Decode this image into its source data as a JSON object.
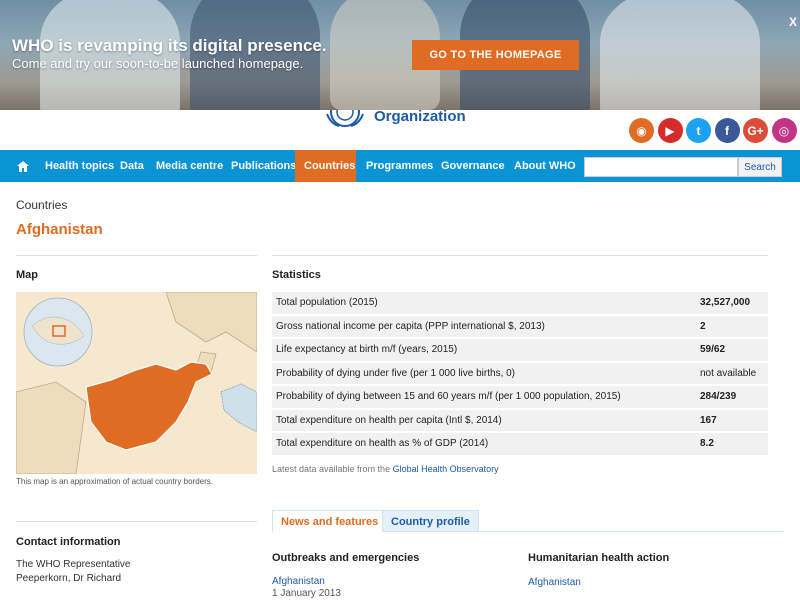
{
  "banner": {
    "title": "WHO is revamping its digital presence.",
    "subtitle": "Come and try our soon-to-be launched homepage.",
    "cta_label": "GO TO THE HOMEPAGE",
    "close_label": "X"
  },
  "header": {
    "logo_text": "Organization",
    "social": [
      {
        "icon": "rss-icon",
        "glyph": "◉",
        "color": "#e06b22"
      },
      {
        "icon": "youtube-icon",
        "glyph": "▶",
        "color": "#d62b2b"
      },
      {
        "icon": "twitter-icon",
        "glyph": "t",
        "color": "#1da1f2"
      },
      {
        "icon": "facebook-icon",
        "glyph": "f",
        "color": "#3b5998"
      },
      {
        "icon": "google-plus-icon",
        "glyph": "G+",
        "color": "#dd4b39"
      },
      {
        "icon": "instagram-icon",
        "glyph": "◎",
        "color": "#c13584"
      }
    ]
  },
  "nav": {
    "items": [
      "Health topics",
      "Data",
      "Media centre",
      "Publications",
      "Countries",
      "Programmes",
      "Governance",
      "About WHO"
    ],
    "active": "Countries",
    "search_placeholder": "",
    "search_label": "Search"
  },
  "page": {
    "breadcrumb": "Countries",
    "country": "Afghanistan"
  },
  "map": {
    "title": "Map",
    "caption": "This map is an approximation of actual country borders."
  },
  "stats": {
    "title": "Statistics",
    "rows": [
      {
        "label": "Total population (2015)",
        "value": "32,527,000"
      },
      {
        "label": "Gross national income per capita (PPP international $, 2013)",
        "value": "2"
      },
      {
        "label": "Life expectancy at birth m/f (years, 2015)",
        "value": "59/62"
      },
      {
        "label": "Probability of dying under five (per 1 000 live births, 0)",
        "value": "not available"
      },
      {
        "label": "Probability of dying between 15 and 60 years m/f (per 1 000 population, 2015)",
        "value": "284/239"
      },
      {
        "label": "Total expenditure on health per capita (Intl $, 2014)",
        "value": "167"
      },
      {
        "label": "Total expenditure on health as % of GDP (2014)",
        "value": "8.2"
      }
    ],
    "note_prefix": "Latest data available from the ",
    "note_link": "Global Health Observatory"
  },
  "tabs": {
    "news": "News and features",
    "profile": "Country profile"
  },
  "contact": {
    "title": "Contact information",
    "line1": "The WHO Representative",
    "line2": "Peeperkorn, Dr Richard"
  },
  "outbreaks": {
    "title": "Outbreaks and emergencies",
    "link": "Afghanistan",
    "date": "1 January 2013"
  },
  "humanitarian": {
    "title": "Humanitarian health action",
    "link": "Afghanistan"
  },
  "colors": {
    "accent": "#e06b22",
    "nav": "#0a93d5",
    "link": "#1f5aa6"
  }
}
